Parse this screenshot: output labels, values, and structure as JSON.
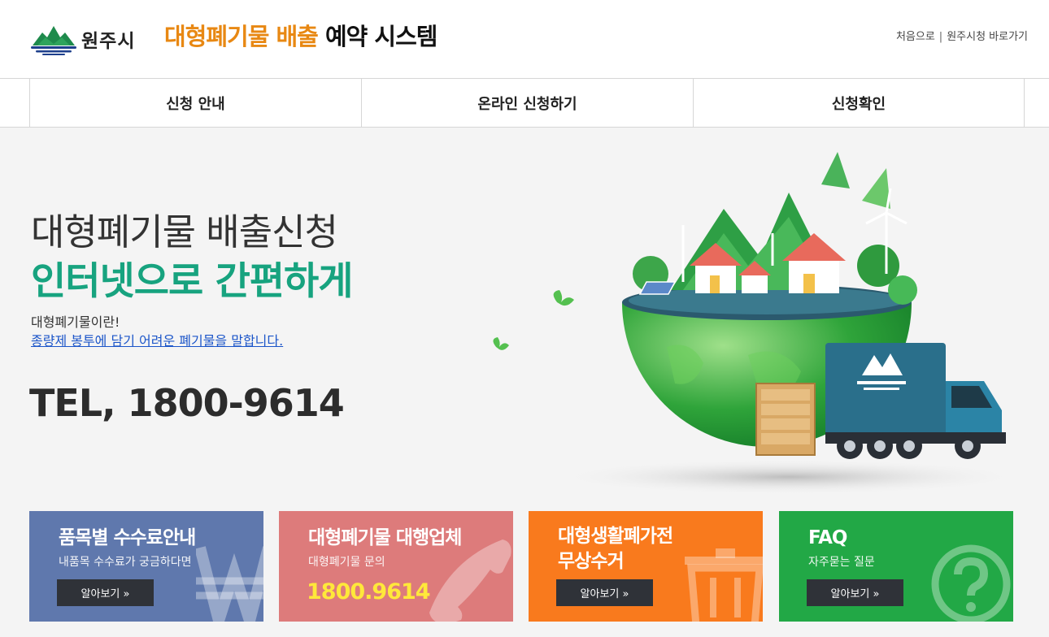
{
  "header": {
    "logo_text": "원주시",
    "title_accent": "대형폐기물 배출",
    "title_rest": "예약 시스템",
    "links": [
      "처음으로",
      "원주시청 바로가기"
    ],
    "link_sep": "|"
  },
  "nav": {
    "items": [
      {
        "label": "신청 안내"
      },
      {
        "label": "온라인 신청하기"
      },
      {
        "label": "신청확인"
      }
    ]
  },
  "hero": {
    "line1": "대형폐기물 배출신청",
    "line2": "인터넷으로 간편하게",
    "desc1": "대형폐기물이란!",
    "desc2": "종량제 봉투에 담기 어려운 폐기물을 말합니다.",
    "tel": "TEL, 1800-9614"
  },
  "cards": [
    {
      "title": "품목별 수수료안내",
      "sub": "내품목 수수료가 궁금하다면",
      "button": "알아보기 »",
      "color": "#5f78ad",
      "icon": "won-icon"
    },
    {
      "title": "대형폐기물 대행업체",
      "sub": "대형폐기물 문의",
      "phone": "1800.9614",
      "color": "#dd7b7b",
      "icon": "phone-icon"
    },
    {
      "title1": "대형생활폐가전",
      "title2": "무상수거",
      "button": "알아보기 »",
      "color": "#f97a1d",
      "icon": "trash-icon"
    },
    {
      "title": "FAQ",
      "sub": "자주묻는 질문",
      "button": "알아보기 »",
      "color": "#22a846",
      "icon": "question-icon"
    }
  ]
}
